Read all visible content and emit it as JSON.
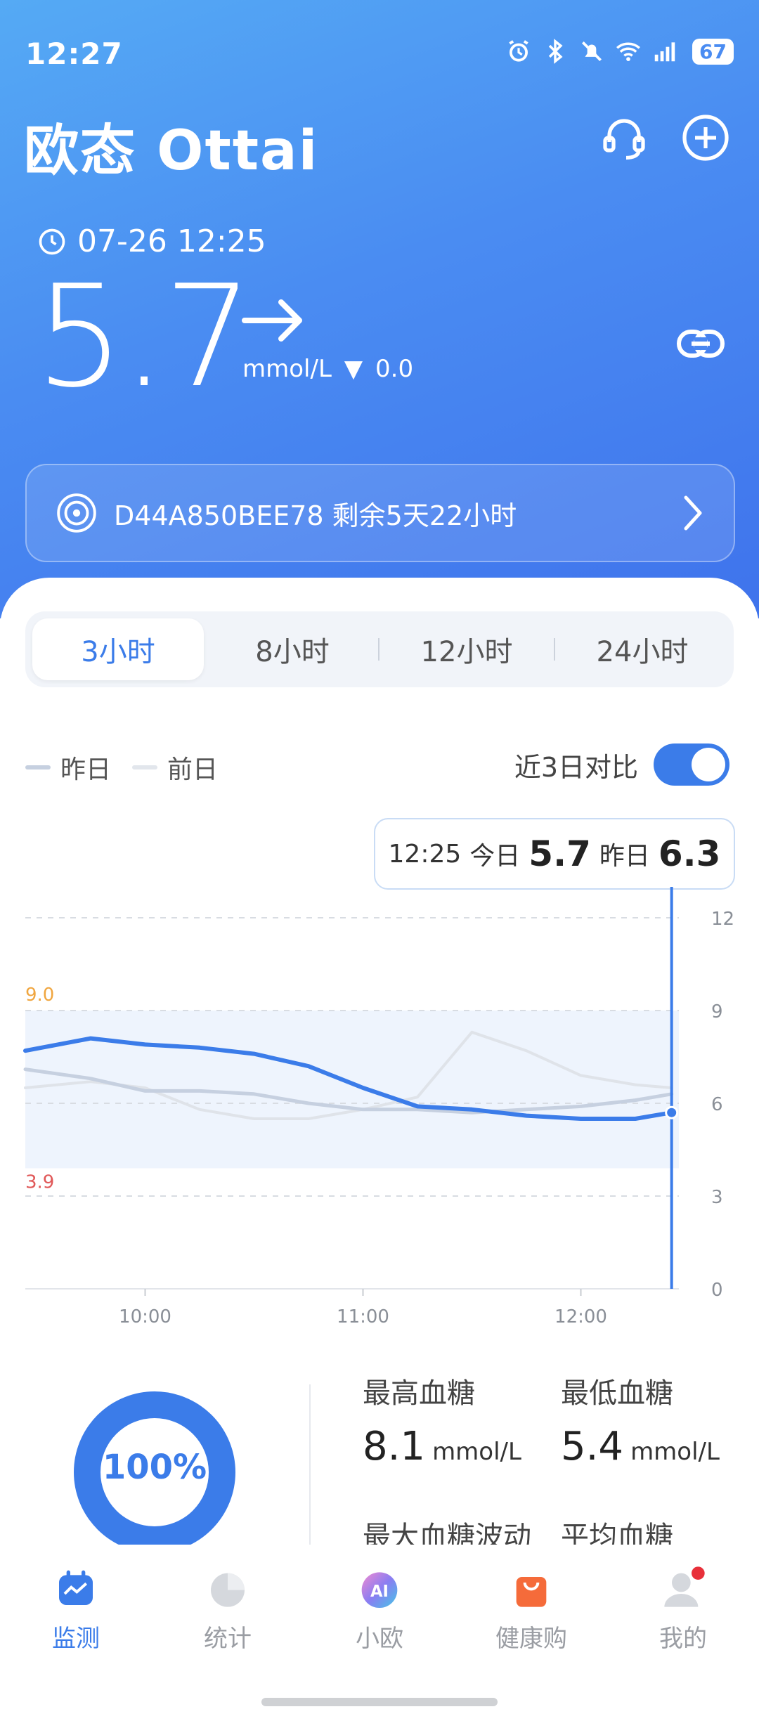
{
  "status_bar": {
    "time": "12:27",
    "battery": "67"
  },
  "header": {
    "brand": "欧态 Ottai"
  },
  "reading": {
    "timestamp": "07-26 12:25",
    "value": "5.7",
    "unit": "mmol/L",
    "delta_symbol": "▼",
    "delta": "0.0"
  },
  "sensor": {
    "label": "D44A850BEE78 剩余5天22小时"
  },
  "range_tabs": [
    "3小时",
    "8小时",
    "12小时",
    "24小时"
  ],
  "legend": {
    "yesterday": "昨日",
    "day_before": "前日",
    "compare_label": "近3日对比"
  },
  "tooltip": {
    "time": "12:25",
    "today_label": "今日",
    "today_value": "5.7",
    "yesterday_label": "昨日",
    "yesterday_value": "6.3"
  },
  "chart_data": {
    "type": "line",
    "x_ticks": [
      "10:00",
      "11:00",
      "12:00"
    ],
    "y_ticks": [
      0,
      3,
      6,
      9,
      12
    ],
    "ylim": [
      0,
      13
    ],
    "target_range": {
      "low": 3.9,
      "high": 9.0,
      "low_label": "3.9",
      "high_label": "9.0"
    },
    "series": [
      {
        "name": "今日",
        "x": [
          "09:27",
          "09:45",
          "10:00",
          "10:15",
          "10:30",
          "10:45",
          "11:00",
          "11:15",
          "11:30",
          "11:45",
          "12:00",
          "12:15",
          "12:25"
        ],
        "values": [
          7.7,
          8.1,
          7.9,
          7.8,
          7.6,
          7.2,
          6.5,
          5.9,
          5.8,
          5.6,
          5.5,
          5.5,
          5.7
        ]
      },
      {
        "name": "昨日",
        "x": [
          "09:27",
          "09:45",
          "10:00",
          "10:15",
          "10:30",
          "10:45",
          "11:00",
          "11:15",
          "11:30",
          "11:45",
          "12:00",
          "12:15",
          "12:25"
        ],
        "values": [
          7.1,
          6.8,
          6.4,
          6.4,
          6.3,
          6.0,
          5.8,
          5.8,
          5.7,
          5.8,
          5.9,
          6.1,
          6.3
        ]
      },
      {
        "name": "前日",
        "x": [
          "09:27",
          "09:45",
          "10:00",
          "10:15",
          "10:30",
          "10:45",
          "11:00",
          "11:15",
          "11:30",
          "11:45",
          "12:00",
          "12:15",
          "12:25"
        ],
        "values": [
          6.5,
          6.7,
          6.5,
          5.8,
          5.5,
          5.5,
          5.8,
          6.2,
          8.3,
          7.7,
          6.9,
          6.6,
          6.5
        ]
      }
    ]
  },
  "summary": {
    "tir": "100%",
    "max_label": "最高血糖",
    "max_value": "8.1",
    "max_unit": "mmol/L",
    "min_label": "最低血糖",
    "min_value": "5.4",
    "min_unit": "mmol/L",
    "fluct_label": "最大血糖波动",
    "avg_label": "平均血糖"
  },
  "tabs": [
    "监测",
    "统计",
    "小欧",
    "健康购",
    "我的"
  ],
  "colors": {
    "accent": "#3b7ce9",
    "high": "#f0a640",
    "low": "#e05858"
  }
}
